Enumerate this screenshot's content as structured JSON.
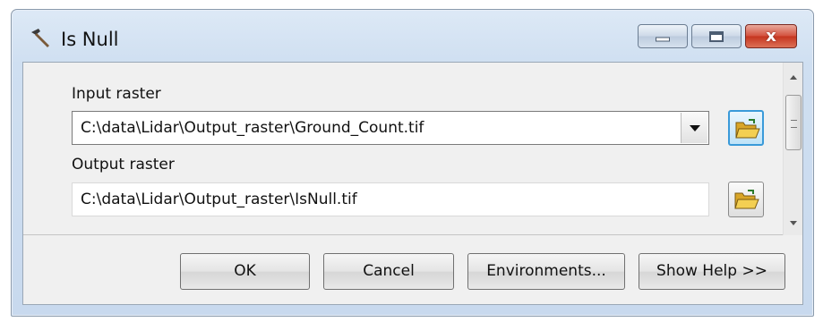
{
  "window": {
    "title": "Is Null",
    "icon": "hammer-icon"
  },
  "controls": {
    "minimize_icon": "minimize-icon",
    "maximize_icon": "maximize-icon",
    "close_icon": "close-icon",
    "close_glyph": "x"
  },
  "params": {
    "input_raster": {
      "label": "Input raster",
      "value": "C:\\data\\Lidar\\Output_raster\\Ground_Count.tif"
    },
    "output_raster": {
      "label": "Output raster",
      "value": "C:\\data\\Lidar\\Output_raster\\IsNull.tif"
    },
    "browse_icon": "open-folder-icon"
  },
  "buttons": {
    "ok": "OK",
    "cancel": "Cancel",
    "environments": "Environments...",
    "show_help": "Show Help >>"
  },
  "colors": {
    "title_bar": "#cfdff1",
    "close_button": "#c5341e",
    "focused_browse_border": "#3a9ad9"
  }
}
